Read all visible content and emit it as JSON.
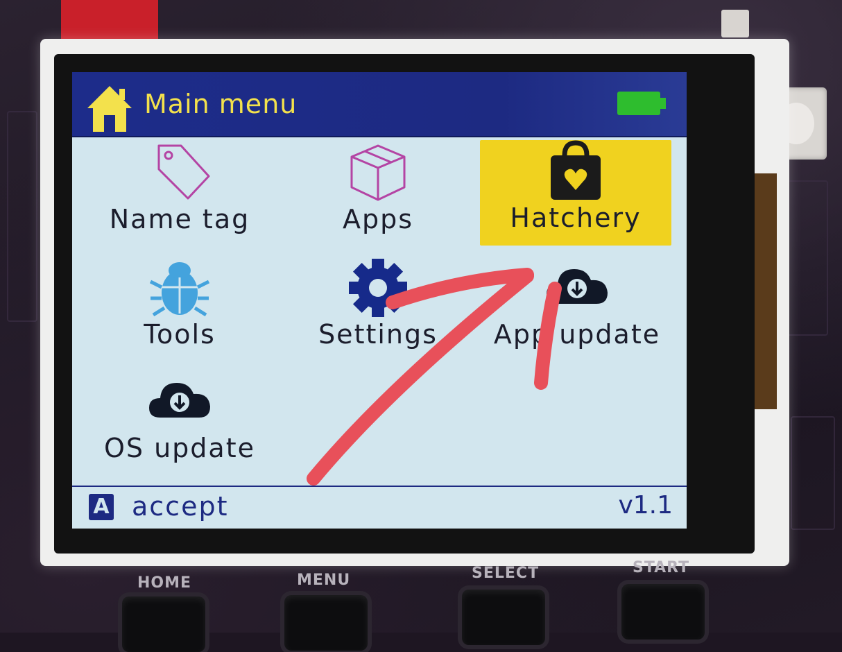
{
  "header": {
    "title": "Main menu",
    "battery_level": 1.0
  },
  "menu": {
    "items": [
      {
        "label": "Name tag",
        "icon": "tag-icon",
        "selected": false
      },
      {
        "label": "Apps",
        "icon": "box-icon",
        "selected": false
      },
      {
        "label": "Hatchery",
        "icon": "shopping-bag-heart-icon",
        "selected": true
      },
      {
        "label": "Tools",
        "icon": "bug-icon",
        "selected": false
      },
      {
        "label": "Settings",
        "icon": "gear-icon",
        "selected": false
      },
      {
        "label": "App update",
        "icon": "cloud-download-icon",
        "selected": false
      },
      {
        "label": "OS update",
        "icon": "cloud-download-icon",
        "selected": false
      }
    ]
  },
  "status": {
    "button_key": "A",
    "action": "accept",
    "version": "v1.1"
  },
  "hardware_buttons": [
    "HOME",
    "MENU",
    "SELECT",
    "START"
  ],
  "colors": {
    "title_bar": "#1d2a82",
    "title_text": "#f3e14c",
    "selection": "#f0d21f",
    "screen_bg": "#d2e6ee",
    "annotation": "#e8505a"
  }
}
